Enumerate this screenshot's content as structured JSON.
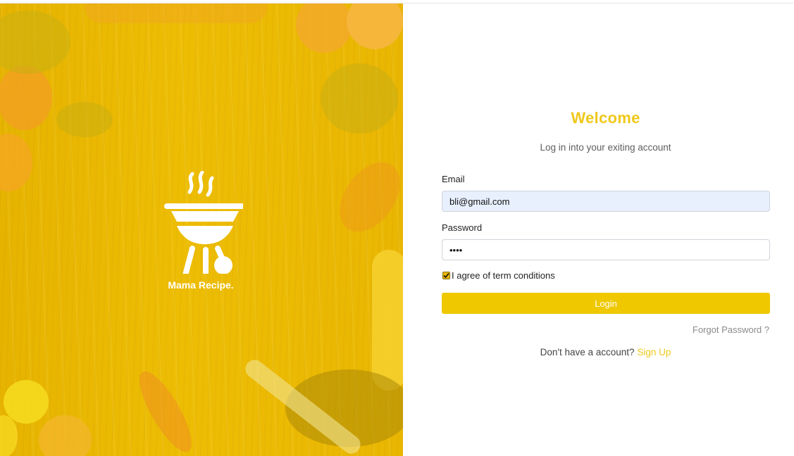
{
  "brand": {
    "name": "Mama Recipe.",
    "icon": "grill-icon"
  },
  "login": {
    "title": "Welcome",
    "subtitle": "Log in into your exiting account",
    "email_label": "Email",
    "email_value": "bli@gmail.com",
    "password_label": "Password",
    "password_value": "abcd",
    "agree_label": "I agree of term conditions",
    "agree_checked": true,
    "login_button": "Login",
    "forgot_link": "Forgot Password ?",
    "signup_prompt": "Don't have a account?",
    "signup_link": "Sign Up"
  },
  "colors": {
    "accent": "#efc800",
    "panel": "#e9b602",
    "input_autofill": "#e8f0fe"
  }
}
